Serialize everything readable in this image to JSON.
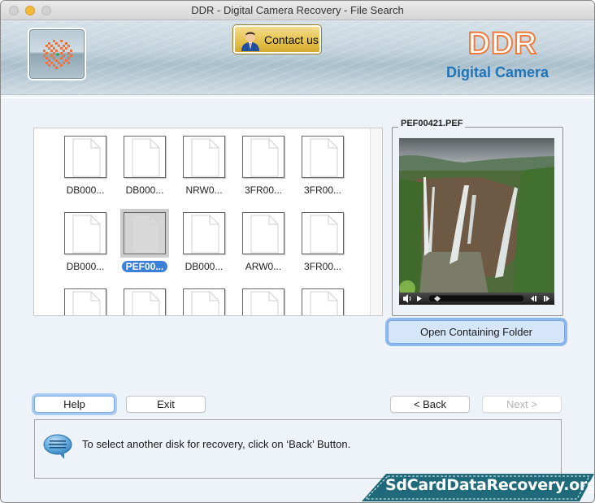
{
  "window": {
    "title": "DDR - Digital Camera Recovery - File Search"
  },
  "banner": {
    "contact_label": "Contact us",
    "brand_name": "DDR",
    "brand_subtitle": "Digital Camera",
    "brand_color": "#f07a3c",
    "subtitle_color": "#1f74b8"
  },
  "files": {
    "items": [
      {
        "name": "DB000...",
        "selected": false
      },
      {
        "name": "DB000...",
        "selected": false
      },
      {
        "name": "NRW0...",
        "selected": false
      },
      {
        "name": "3FR00...",
        "selected": false
      },
      {
        "name": "3FR00...",
        "selected": false
      },
      {
        "name": "DB000...",
        "selected": false
      },
      {
        "name": "PEF00...",
        "selected": true
      },
      {
        "name": "DB000...",
        "selected": false
      },
      {
        "name": "ARW0...",
        "selected": false
      },
      {
        "name": "3FR00...",
        "selected": false
      },
      {
        "name": "",
        "selected": false
      },
      {
        "name": "",
        "selected": false
      },
      {
        "name": "",
        "selected": false
      },
      {
        "name": "",
        "selected": false
      },
      {
        "name": "",
        "selected": false
      }
    ],
    "selection_color": "#3b7fd9"
  },
  "preview": {
    "filename": "PEF00421.PEF",
    "image_description": "waterfall landscape",
    "open_folder_label": "Open Containing Folder"
  },
  "buttons": {
    "help": "Help",
    "exit": "Exit",
    "back": "< Back",
    "next": "Next >"
  },
  "status": {
    "message": "To select another disk for recovery, click on ‘Back’ Button."
  },
  "watermark": {
    "text": "SdCardDataRecovery.org",
    "color": "#1f6a7a"
  }
}
